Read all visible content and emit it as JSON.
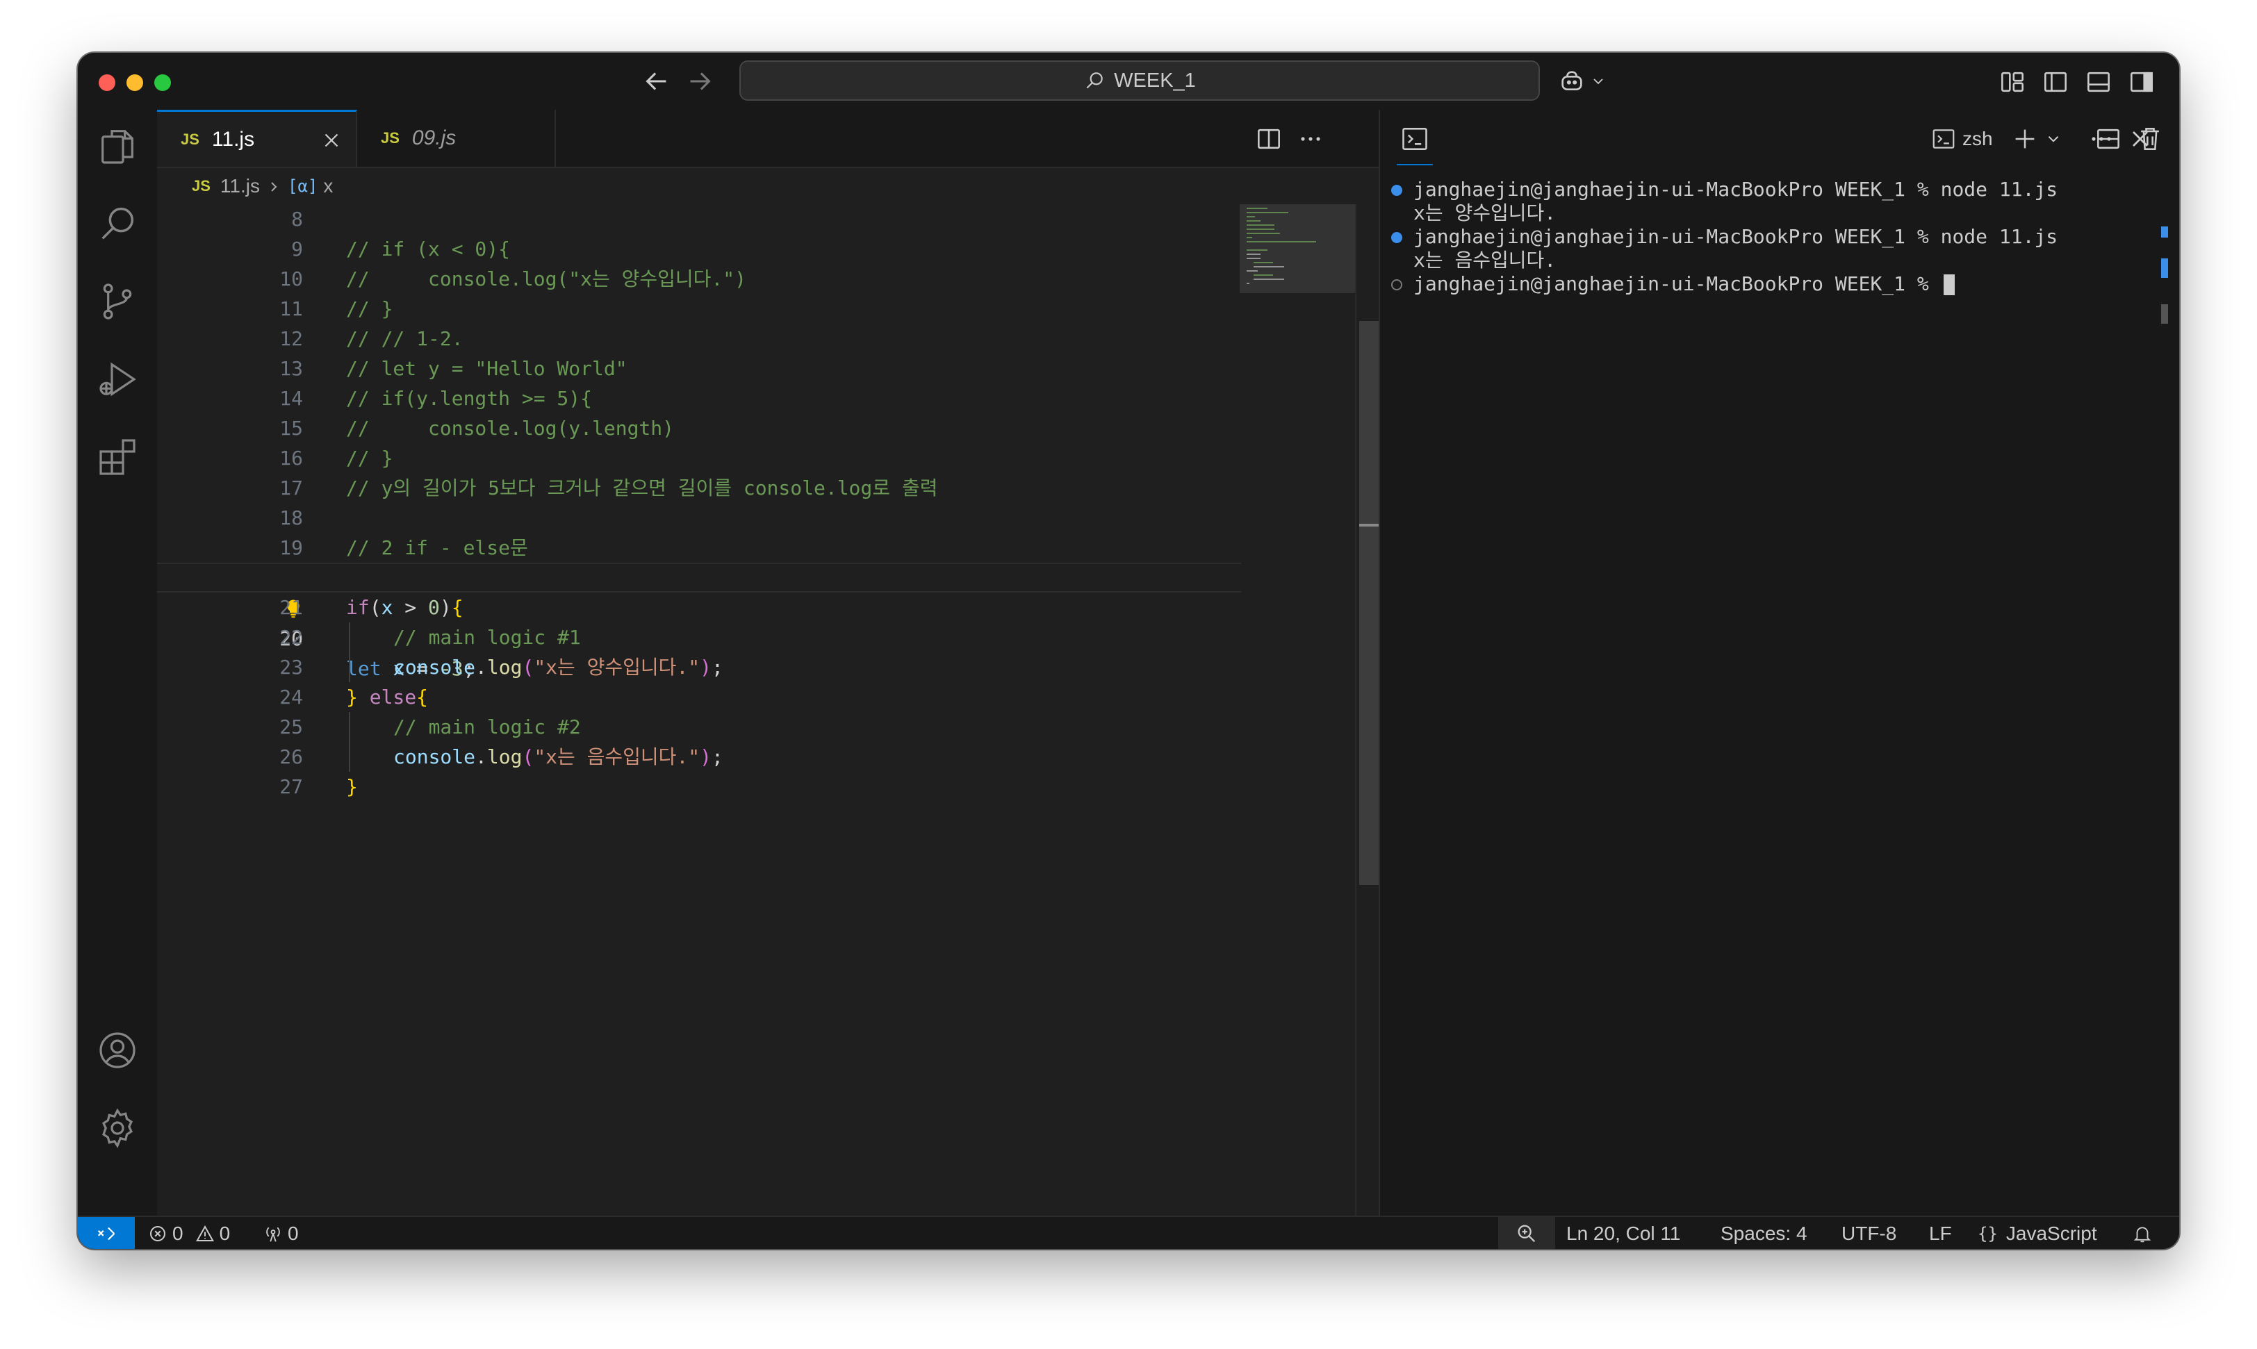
{
  "titlebar": {
    "search_text": "WEEK_1"
  },
  "editor": {
    "tabs": [
      {
        "label": "11.js",
        "active": true
      },
      {
        "label": "09.js",
        "active": false
      }
    ],
    "file_badge": "JS",
    "breadcrumb": {
      "file": "11.js",
      "symbol_icon": "[α]",
      "symbol": "x"
    },
    "current_line": 20,
    "lines": [
      {
        "n": "8"
      },
      {
        "n": "9"
      },
      {
        "n": "10"
      },
      {
        "n": "11"
      },
      {
        "n": "12"
      },
      {
        "n": "13"
      },
      {
        "n": "14"
      },
      {
        "n": "15"
      },
      {
        "n": "16"
      },
      {
        "n": "17"
      },
      {
        "n": "18"
      },
      {
        "n": "19"
      },
      {
        "n": "20"
      },
      {
        "n": "21"
      },
      {
        "n": "22"
      },
      {
        "n": "23"
      },
      {
        "n": "24"
      },
      {
        "n": "25"
      },
      {
        "n": "26"
      },
      {
        "n": "27"
      }
    ],
    "code": {
      "l9": "// if (x < 0){",
      "l10": "//     console.log(\"x는 양수입니다.\")",
      "l11": "// }",
      "l12": "// // 1-2.",
      "l13": "// let y = \"Hello World\"",
      "l14": "// if(y.length >= 5){",
      "l15": "//     console.log(y.length)",
      "l16": "// }",
      "l17": "// y의 길이가 5보다 크거나 같으면 길이를 console.log로 출력",
      "l19": "// 2 if - else문",
      "l20_kw": "let",
      "l20_var": "x",
      "l20_op": " = ",
      "l20_num": "-3",
      "l20_end": ";",
      "l21_kw": "if",
      "l21_open": "(",
      "l21_var": "x",
      "l21_op": " > ",
      "l21_num": "0",
      "l21_close": ")",
      "l21_brace": "{",
      "l22": "// main logic #1",
      "l23_obj": "console",
      "l23_dot": ".",
      "l23_fn": "log",
      "l23_open": "(",
      "l23_str": "\"x는 양수입니다.\"",
      "l23_close": ")",
      "l23_end": ";",
      "l24_brace": "}",
      "l24_kw": " else",
      "l24_brace2": "{",
      "l25": "// main logic #2",
      "l26_obj": "console",
      "l26_dot": ".",
      "l26_fn": "log",
      "l26_open": "(",
      "l26_str": "\"x는 음수입니다.\"",
      "l26_close": ")",
      "l26_end": ";",
      "l27_brace": "}"
    }
  },
  "terminal": {
    "shell_label": "zsh",
    "lines": [
      "janghaejin@janghaejin-ui-MacBookPro WEEK_1 % node 11.js",
      "x는 양수입니다.",
      "janghaejin@janghaejin-ui-MacBookPro WEEK_1 % node 11.js",
      "x는 음수입니다.",
      "janghaejin@janghaejin-ui-MacBookPro WEEK_1 % "
    ]
  },
  "statusbar": {
    "errors": "0",
    "warnings": "0",
    "ports": "0",
    "position": "Ln 20, Col 11",
    "spaces": "Spaces: 4",
    "encoding": "UTF-8",
    "eol": "LF",
    "language_icon": "{}",
    "language": "JavaScript"
  },
  "colors": {
    "accent": "#0078d4",
    "js_badge": "#cbcb41",
    "comment": "#6a9955",
    "string": "#ce9178"
  },
  "icons": [
    "close-window",
    "minimize-window",
    "maximize-window",
    "arrow-left-icon",
    "arrow-right-icon",
    "search-icon",
    "copilot-icon",
    "customize-layout-icon",
    "toggle-sidebar-icon",
    "toggle-panel-icon",
    "toggle-secondary-sidebar-icon",
    "explorer-icon",
    "search-icon",
    "source-control-icon",
    "run-debug-icon",
    "extensions-icon",
    "account-icon",
    "gear-icon",
    "split-editor-icon",
    "more-icon",
    "close-icon",
    "lightbulb-icon",
    "terminal-icon",
    "plus-icon",
    "chevron-down-icon",
    "split-terminal-icon",
    "trash-icon",
    "remote-icon",
    "error-icon",
    "warning-icon",
    "broadcast-icon",
    "zoom-icon",
    "bell-icon"
  ]
}
